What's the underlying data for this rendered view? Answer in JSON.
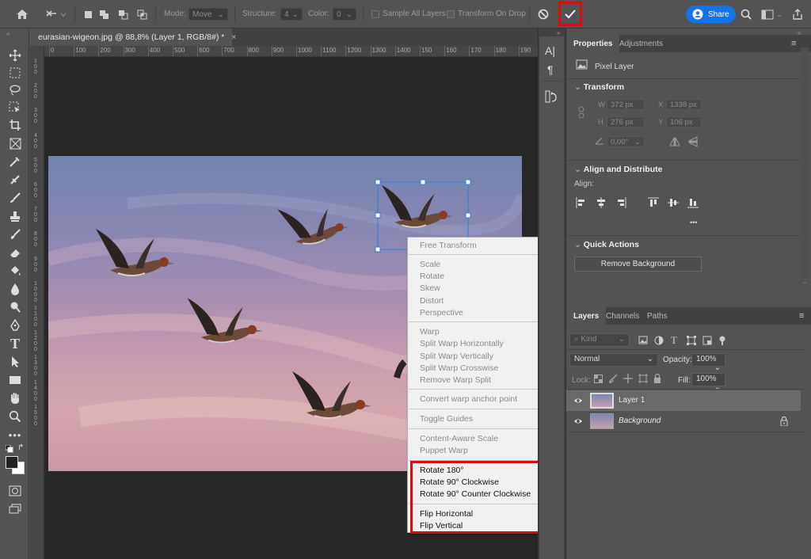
{
  "toolbar_options": {
    "mode_label": "Mode:",
    "mode_value": "Move",
    "structure_label": "Structure:",
    "structure_value": "4",
    "color_label": "Color:",
    "color_value": "0",
    "sample_all_layers": "Sample All Layers",
    "transform_on_drop": "Transform On Drop",
    "share": "Share"
  },
  "document": {
    "tab_title": "eurasian-wigeon.jpg @ 88,8% (Layer 1, RGB/8#) *",
    "close": "×"
  },
  "ruler": {
    "h_ticks": [
      "0",
      "100",
      "200",
      "300",
      "400",
      "500",
      "600",
      "700",
      "800",
      "900",
      "1000",
      "1100",
      "1200",
      "1300",
      "1400",
      "150",
      "160",
      "170",
      "180",
      "190"
    ],
    "v_ticks": [
      "1\n0\n0",
      "2\n0\n0",
      "3\n0\n0",
      "4\n0\n0",
      "5\n0\n0",
      "6\n0\n0",
      "7\n0\n0",
      "8\n0\n0",
      "9\n0\n0",
      "1\n0\n0\n0",
      "1\n1\n0\n0",
      "1\n2\n0\n0",
      "1\n3\n0\n0",
      "1\n4\n0\n0",
      "1\n5\n0\n0"
    ]
  },
  "context_menu": {
    "free_transform": "Free Transform",
    "scale": "Scale",
    "rotate": "Rotate",
    "skew": "Skew",
    "distort": "Distort",
    "perspective": "Perspective",
    "warp": "Warp",
    "split_warp_h": "Split Warp Horizontally",
    "split_warp_v": "Split Warp Vertically",
    "split_warp_c": "Split Warp Crosswise",
    "remove_warp_split": "Remove Warp Split",
    "convert_anchor": "Convert warp anchor point",
    "toggle_guides": "Toggle Guides",
    "content_aware_scale": "Content-Aware Scale",
    "puppet_warp": "Puppet Warp",
    "rotate_180": "Rotate 180°",
    "rotate_90_cw": "Rotate 90° Clockwise",
    "rotate_90_ccw": "Rotate 90° Counter Clockwise",
    "flip_h": "Flip Horizontal",
    "flip_v": "Flip Vertical"
  },
  "properties": {
    "tab_properties": "Properties",
    "tab_adjustments": "Adjustments",
    "layer_type": "Pixel Layer",
    "transform_title": "Transform",
    "w_label": "W",
    "w_value": "372 px",
    "h_label": "H",
    "h_value": "276 px",
    "x_label": "X",
    "x_value": "1338 px",
    "y_label": "Y",
    "y_value": "106 px",
    "angle_value": "0,00°",
    "align_title": "Align and Distribute",
    "align_label": "Align:",
    "more": "•••",
    "quick_actions_title": "Quick Actions",
    "remove_background": "Remove Background"
  },
  "layers": {
    "tab_layers": "Layers",
    "tab_channels": "Channels",
    "tab_paths": "Paths",
    "kind_placeholder": "Kind",
    "blend_mode": "Normal",
    "opacity_label": "Opacity:",
    "opacity_value": "100%",
    "lock_label": "Lock:",
    "fill_label": "Fill:",
    "fill_value": "100%",
    "items": [
      {
        "name": "Layer 1"
      },
      {
        "name": "Background"
      }
    ]
  }
}
